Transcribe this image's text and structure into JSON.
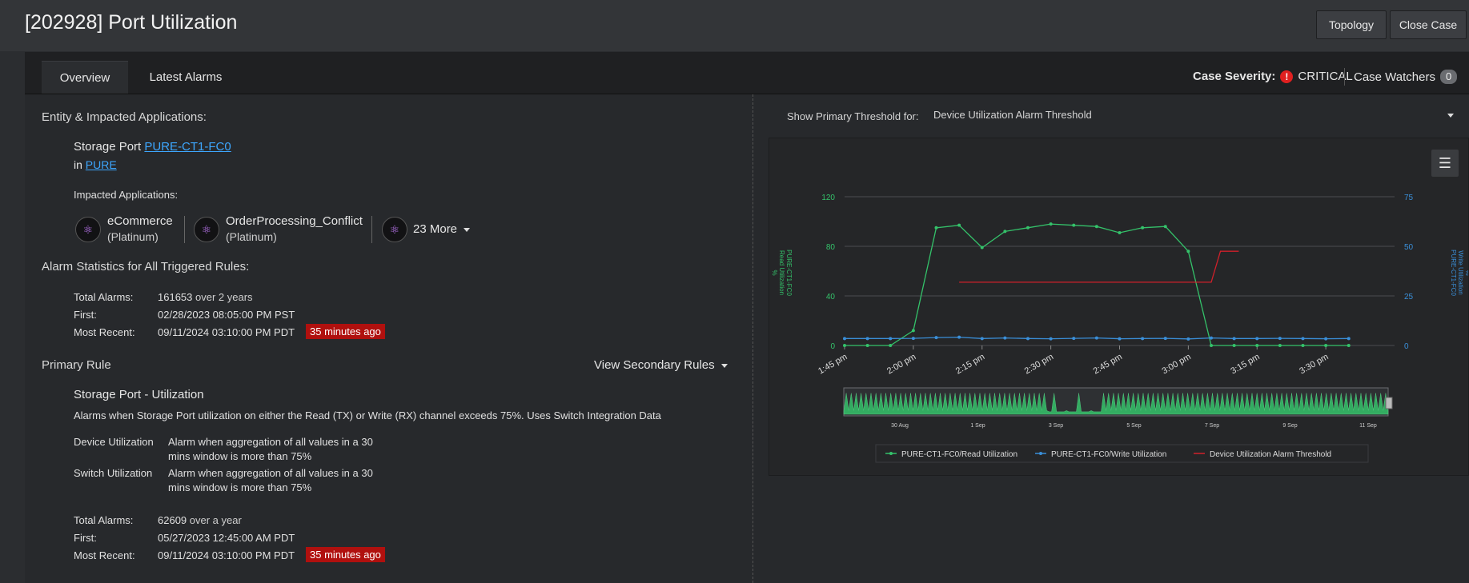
{
  "header": {
    "title": "[202928] Port Utilization",
    "topology_label": "Topology",
    "close_case_label": "Close Case"
  },
  "tabs": [
    {
      "label": "Overview",
      "active": true
    },
    {
      "label": "Latest Alarms",
      "active": false
    }
  ],
  "case": {
    "severity_label": "Case Severity:",
    "severity_value": "CRITICAL",
    "watchers_label": "Case Watchers",
    "watchers_count": "0"
  },
  "entity": {
    "section_title": "Entity & Impacted Applications:",
    "type": "Storage Port",
    "name": "PURE-CT1-FC0",
    "in_label": "in",
    "parent": "PURE",
    "impacted_label": "Impacted Applications:",
    "apps": [
      {
        "name": "eCommerce",
        "tier": "(Platinum)"
      },
      {
        "name": "OrderProcessing_Conflict",
        "tier": "(Platinum)"
      }
    ],
    "more_label": "23 More"
  },
  "alarm_stats": {
    "section_title": "Alarm Statistics for All Triggered Rules:",
    "total_label": "Total Alarms:",
    "total_value": "161653",
    "total_suffix": "over 2 years",
    "first_label": "First:",
    "first_value": "02/28/2023 08:05:00 PM PST",
    "recent_label": "Most Recent:",
    "recent_value": "09/11/2024 03:10:00 PM PDT",
    "recent_ago": "35 minutes ago"
  },
  "primary_rule": {
    "section_title": "Primary Rule",
    "secondary_label": "View Secondary Rules",
    "name": "Storage Port - Utilization",
    "description": "Alarms when Storage Port utilization on either the Read (TX) or Write (RX) channel exceeds 75%. Uses Switch Integration Data",
    "conditions": [
      {
        "label": "Device Utilization",
        "line1": "Alarm when aggregation of all values in a 30",
        "line2": "mins window is more than 75%"
      },
      {
        "label": "Switch Utilization",
        "line1": "Alarm when aggregation of all values in a 30",
        "line2": "mins window is more than 75%"
      }
    ],
    "total_label": "Total Alarms:",
    "total_value": "62609",
    "total_suffix": "over a year",
    "first_label": "First:",
    "first_value": "05/27/2023 12:45:00 AM PDT",
    "recent_label": "Most Recent:",
    "recent_value": "09/11/2024 03:10:00 PM PDT",
    "recent_ago": "35 minutes ago"
  },
  "threshold": {
    "label": "Show Primary Threshold for:",
    "value": "Device Utilization Alarm Threshold"
  },
  "icons": {
    "menu": "hamburger-icon",
    "severity": "alert-circle-icon",
    "app": "application-cluster-icon",
    "dropdown": "caret-down-icon"
  },
  "colors": {
    "read": "#34c26a",
    "write": "#3a8fd9",
    "threshold": "#d0202a",
    "critical": "#e02020"
  },
  "chart_data": {
    "type": "line",
    "left_axis_label_1": "PURE-CT1-FC0",
    "left_axis_label_2": "Read Utilization",
    "left_axis_unit": "%",
    "right_axis_label_1": "PURE-CT1-FC0",
    "right_axis_label_2": "Write Utilization",
    "right_axis_unit": "%",
    "left_ticks": [
      "0",
      "40",
      "80",
      "120"
    ],
    "right_ticks": [
      "0",
      "25",
      "50",
      "75"
    ],
    "left_ylim": [
      0,
      120
    ],
    "right_ylim": [
      0,
      75
    ],
    "x_ticks": [
      "1:45 pm",
      "2:00 pm",
      "2:15 pm",
      "2:30 pm",
      "2:45 pm",
      "3:00 pm",
      "3:15 pm",
      "3:30 pm"
    ],
    "nav_ticks": [
      "30 Aug",
      "1 Sep",
      "3 Sep",
      "5 Sep",
      "7 Sep",
      "9 Sep",
      "11 Sep"
    ],
    "grid": true,
    "legend_position": "bottom",
    "series": [
      {
        "name": "PURE-CT1-FC0/Read Utilization",
        "axis": "left",
        "x_minutes": [
          0,
          5,
          10,
          15,
          20,
          25,
          30,
          35,
          40,
          45,
          50,
          55,
          60,
          65,
          70,
          75,
          80,
          85,
          90,
          95,
          100,
          105,
          110
        ],
        "values": [
          0,
          0,
          0,
          12,
          95,
          97,
          79,
          92,
          95,
          98,
          97,
          96,
          91,
          95,
          96,
          76,
          0,
          0,
          0,
          0,
          0,
          0,
          0
        ]
      },
      {
        "name": "PURE-CT1-FC0/Write Utilization",
        "axis": "right",
        "x_minutes": [
          0,
          5,
          10,
          15,
          20,
          25,
          30,
          35,
          40,
          45,
          50,
          55,
          60,
          65,
          70,
          75,
          80,
          85,
          90,
          95,
          100,
          105,
          110
        ],
        "values": [
          3.5,
          3.5,
          3.5,
          3.6,
          4,
          4.2,
          3.5,
          3.8,
          3.5,
          3.4,
          3.6,
          3.8,
          3.4,
          3.5,
          3.6,
          3.3,
          3.8,
          3.5,
          3.5,
          3.6,
          3.5,
          3.4,
          3.5
        ]
      },
      {
        "name": "Device Utilization Alarm Threshold",
        "axis": "left",
        "x_minutes": [
          25,
          80,
          82,
          86
        ],
        "values": [
          51,
          51,
          76,
          76
        ]
      }
    ]
  }
}
